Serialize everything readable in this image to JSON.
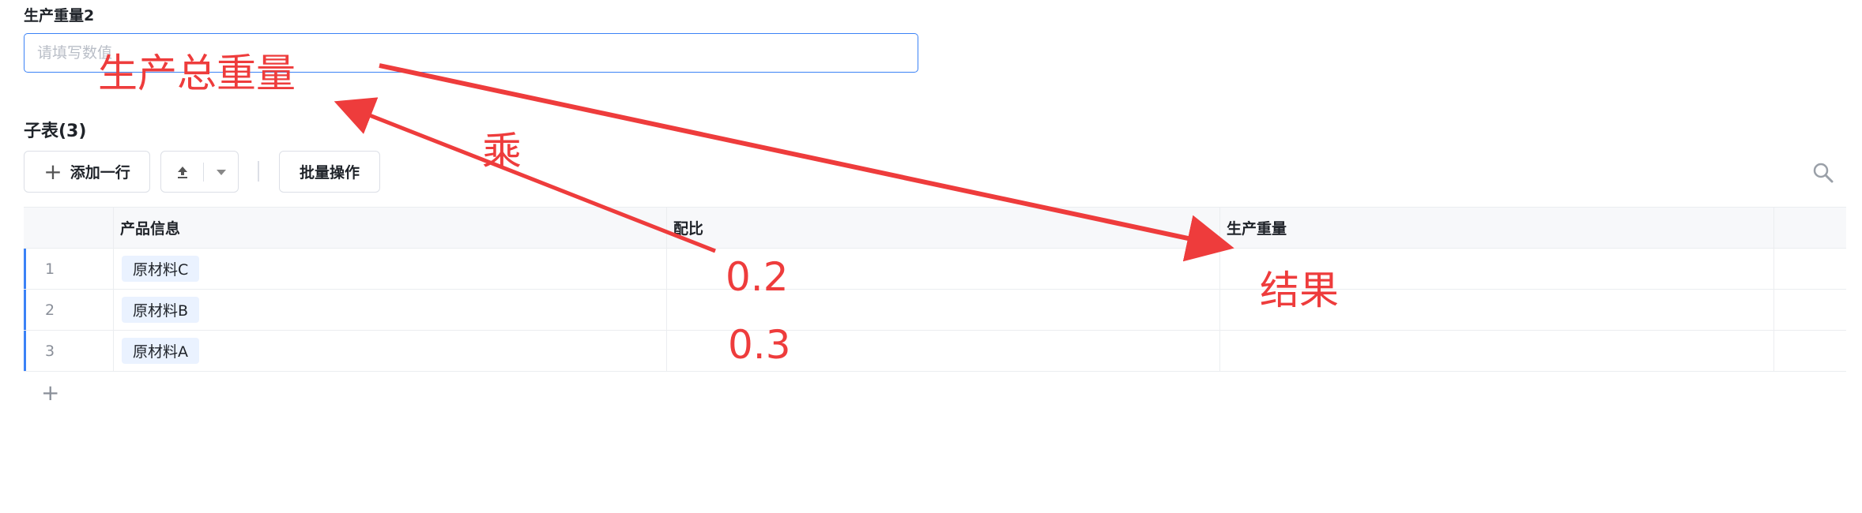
{
  "form": {
    "field_label": "生产重量2",
    "input_placeholder": "请填写数值",
    "input_value": ""
  },
  "subtable": {
    "title": "子表(3)",
    "toolbar": {
      "add_row_label": "添加一行",
      "batch_label": "批量操作"
    },
    "columns": [
      "产品信息",
      "配比",
      "生产重量"
    ],
    "rows": [
      {
        "index": "1",
        "product": "原材料C",
        "ratio": "",
        "weight": ""
      },
      {
        "index": "2",
        "product": "原材料B",
        "ratio": "",
        "weight": ""
      },
      {
        "index": "3",
        "product": "原材料A",
        "ratio": "",
        "weight": ""
      }
    ]
  },
  "annotations": {
    "total_weight": "生产总重量",
    "multiply": "乘",
    "ratio_1": "0.2",
    "ratio_2": "0.3",
    "result": "结果"
  },
  "colors": {
    "accent": "#3b82f6",
    "annotation": "#ee3c3c",
    "tag_bg": "#eaf2ff"
  }
}
